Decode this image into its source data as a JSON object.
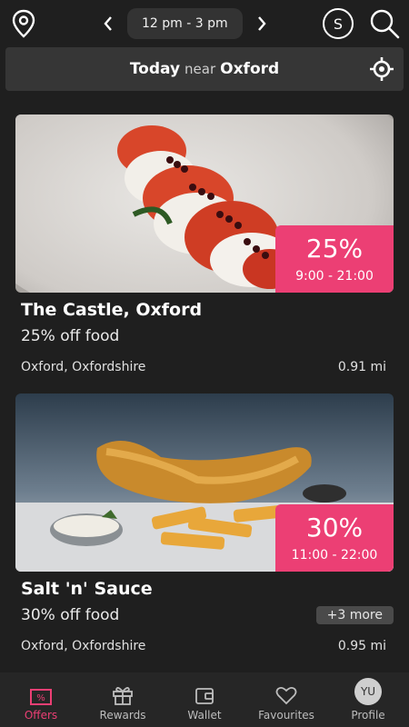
{
  "header": {
    "time_range": "12 pm - 3 pm",
    "s_label": "S"
  },
  "location_bar": {
    "day": "Today",
    "near": "near",
    "place": "Oxford"
  },
  "cards": [
    {
      "percent": "25%",
      "hours": "9:00 - 21:00",
      "title": "The Castle, Oxford",
      "offer": "25% off food",
      "location": "Oxford, Oxfordshire",
      "distance": "0.91 mi",
      "more": ""
    },
    {
      "percent": "30%",
      "hours": "11:00 - 22:00",
      "title": "Salt 'n' Sauce",
      "offer": "30% off food",
      "location": "Oxford, Oxfordshire",
      "distance": "0.95 mi",
      "more": "+3 more"
    }
  ],
  "tabs": [
    {
      "label": "Offers",
      "icon": "offers-icon",
      "active": true
    },
    {
      "label": "Rewards",
      "icon": "gift-icon",
      "active": false
    },
    {
      "label": "Wallet",
      "icon": "wallet-icon",
      "active": false
    },
    {
      "label": "Favourites",
      "icon": "heart-icon",
      "active": false
    },
    {
      "label": "Profile",
      "icon": "avatar",
      "active": false
    }
  ],
  "profile_initials": "YU",
  "colors": {
    "accent": "#ec3f74",
    "background": "#1f1f1f",
    "location_bar": "#363636"
  }
}
